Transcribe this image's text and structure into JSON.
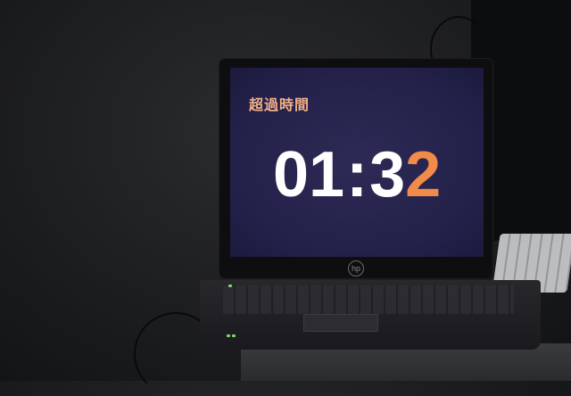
{
  "screen": {
    "title": "超過時間",
    "timer": {
      "minutes": "01",
      "separator": ":",
      "seconds_first_digit": "3",
      "seconds_last_digit_ghost": "2",
      "seconds_last_digit": "2"
    }
  },
  "brand": {
    "logo_text": "hp"
  },
  "colors": {
    "screen_background": "#25234c",
    "title_text": "#f3b089",
    "timer_text": "#ffffff",
    "timer_accent": "#f28a4a",
    "status_led": "#7fd36a"
  },
  "icons": {
    "laptop_logo": "hp-logo-icon"
  }
}
